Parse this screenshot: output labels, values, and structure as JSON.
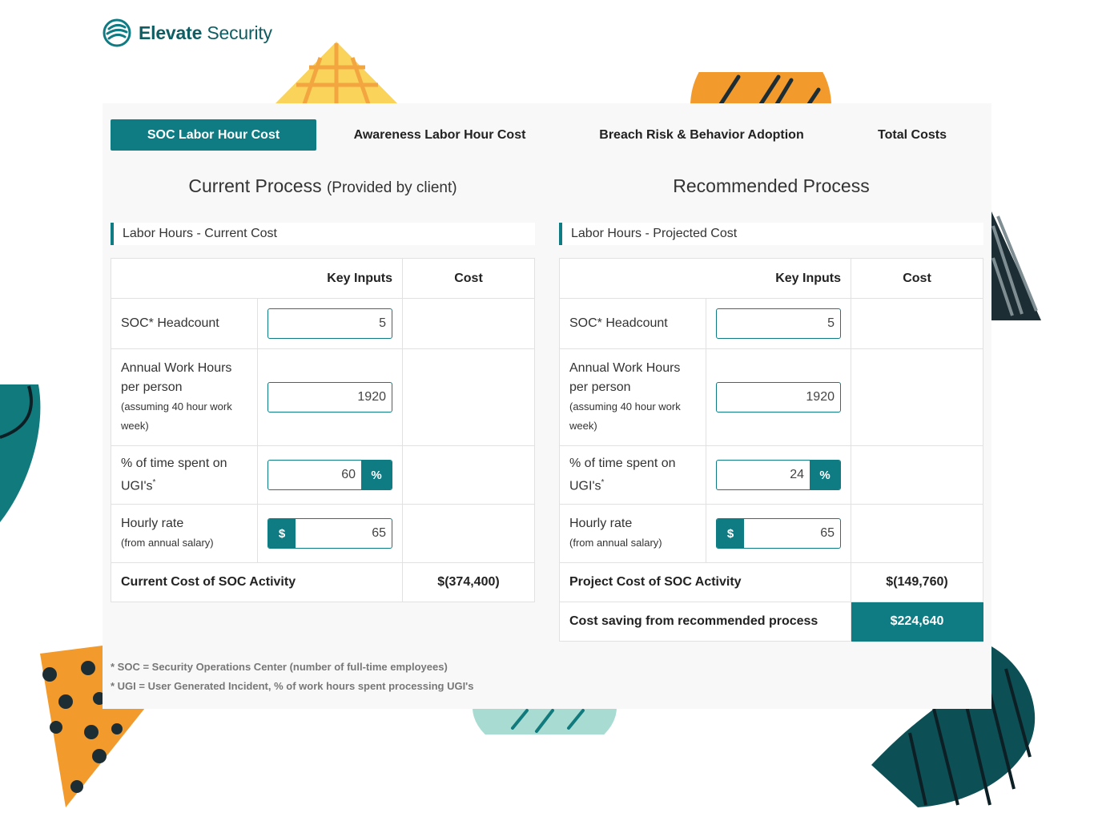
{
  "brand": {
    "name_part1": "Elevate",
    "name_part2": "Security",
    "accent": "#0f7b83"
  },
  "tabs": [
    {
      "label": "SOC Labor Hour Cost",
      "active": true
    },
    {
      "label": "Awareness Labor Hour Cost",
      "active": false
    },
    {
      "label": "Breach Risk & Behavior Adoption",
      "active": false
    },
    {
      "label": "Total Costs",
      "active": false
    }
  ],
  "current": {
    "title": "Current Process",
    "subtitle": "(Provided by client)",
    "section": "Labor Hours - Current Cost",
    "header_inputs": "Key Inputs",
    "header_cost": "Cost",
    "rows": {
      "headcount": {
        "label": "SOC* Headcount",
        "value": "5"
      },
      "hours": {
        "label": "Annual Work Hours per person",
        "note": "(assuming 40 hour work week)",
        "value": "1920"
      },
      "time": {
        "label": "% of time spent on UGI's",
        "sup": "*",
        "value": "60",
        "addon": "%"
      },
      "rate": {
        "label": "Hourly rate",
        "note": "(from annual salary)",
        "value": "65",
        "addon": "$"
      }
    },
    "total_label": "Current Cost of SOC Activity",
    "total_value": "$(374,400)"
  },
  "recommended": {
    "title": "Recommended Process",
    "section": "Labor Hours - Projected Cost",
    "header_inputs": "Key Inputs",
    "header_cost": "Cost",
    "rows": {
      "headcount": {
        "label": "SOC* Headcount",
        "value": "5"
      },
      "hours": {
        "label": "Annual Work Hours per person",
        "note": "(assuming 40 hour work week)",
        "value": "1920"
      },
      "time": {
        "label": "% of time spent on UGI's",
        "sup": "*",
        "value": "24",
        "addon": "%"
      },
      "rate": {
        "label": "Hourly rate",
        "note": "(from annual salary)",
        "value": "65",
        "addon": "$"
      }
    },
    "total_label": "Project Cost of SOC Activity",
    "total_value": "$(149,760)",
    "saving_label": "Cost saving from recommended process",
    "saving_value": "$224,640"
  },
  "footnotes": [
    "* SOC = Security Operations Center (number of full-time employees)",
    "* UGI = User Generated Incident, % of work hours spent processing UGI's"
  ]
}
